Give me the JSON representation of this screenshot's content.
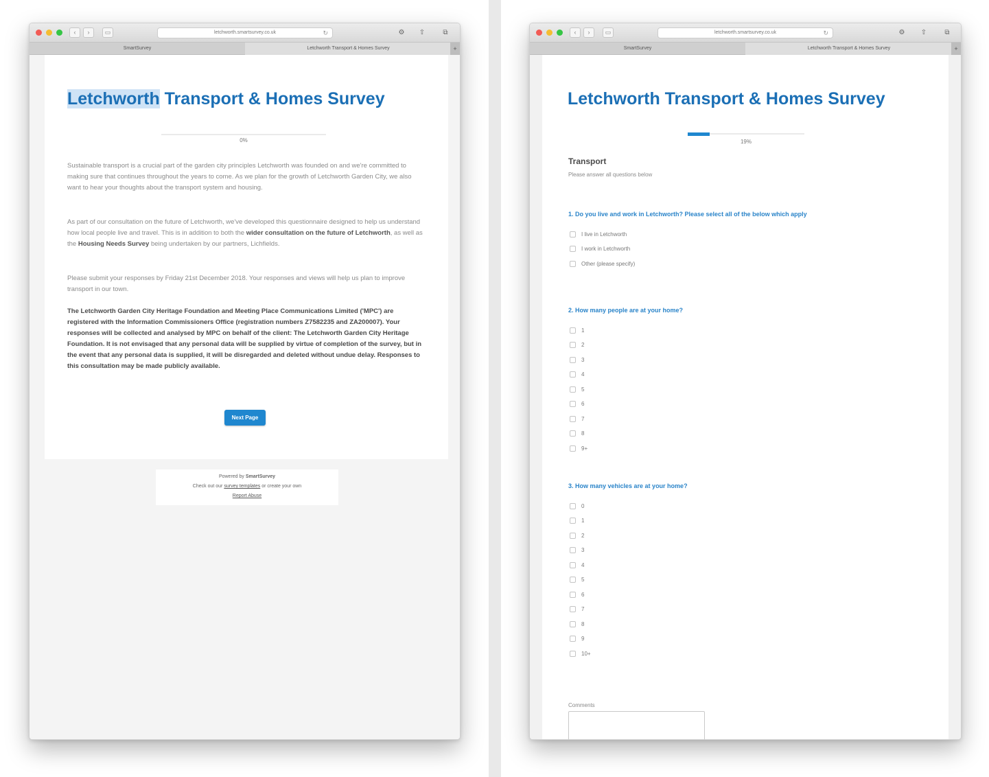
{
  "browser": {
    "url": "letchworth.smartsurvey.co.uk",
    "tab_left": "SmartSurvey",
    "tab_right": "Letchworth Transport & Homes Survey"
  },
  "page1": {
    "title_highlight": "Letchworth",
    "title_rest": " Transport & Homes Survey",
    "progress_label": "0%",
    "progress_value": 0,
    "para1": "Sustainable transport is a crucial part of the garden city principles Letchworth was founded on and we're committed to making sure that continues throughout the years to come. As we plan for the growth of Letchworth Garden City, we also want to hear your thoughts about the transport system and housing.",
    "para2a": "As part of our consultation on the future of Letchworth, we've developed this questionnaire designed to help us understand how local people live and travel. This is in addition to both the ",
    "para2b": "wider consultation on the future of Letchworth",
    "para2c": ", as well as the ",
    "para2d": "Housing Needs Survey",
    "para2e": " being undertaken by our partners, Lichfields.",
    "para3": "Please submit your responses by Friday 21st December 2018. Your responses and views will help us plan to improve transport in our town.",
    "para4": "The Letchworth Garden City Heritage Foundation and Meeting Place Communications Limited ('MPC') are registered with the Information Commissioners Office (registration numbers Z7582235 and ZA200007). Your responses will be collected and analysed by MPC on behalf of the client: The Letchworth Garden City Heritage Foundation. It is not envisaged that any personal data will be supplied by virtue of completion of the survey, but in the event that any personal data is supplied, it will be disregarded and deleted without undue delay. Responses to this consultation may be made publicly available.",
    "next_button": "Next Page",
    "footer_powered": "Powered by",
    "footer_brand": "SmartSurvey",
    "footer_check_a": "Check out our",
    "footer_check_link": "survey templates",
    "footer_check_b": "or create your own",
    "footer_report": "Report Abuse"
  },
  "page2": {
    "title": "Letchworth Transport & Homes Survey",
    "progress_label": "19%",
    "progress_value": 0.19,
    "section_title": "Transport",
    "section_sub": "Please answer all questions below",
    "q1": "1. Do you live and work in Letchworth? Please select all of the below which apply",
    "q1_options": [
      "I live in Letchworth",
      "I work in Letchworth",
      "Other (please specify)"
    ],
    "q2": "2. How many people are at your home?",
    "q2_options": [
      "1",
      "2",
      "3",
      "4",
      "5",
      "6",
      "7",
      "8",
      "9+"
    ],
    "q3": "3. How many vehicles are at your home?",
    "q3_options": [
      "0",
      "1",
      "2",
      "3",
      "4",
      "5",
      "6",
      "7",
      "8",
      "9",
      "10+"
    ],
    "comments_label": "Comments"
  }
}
